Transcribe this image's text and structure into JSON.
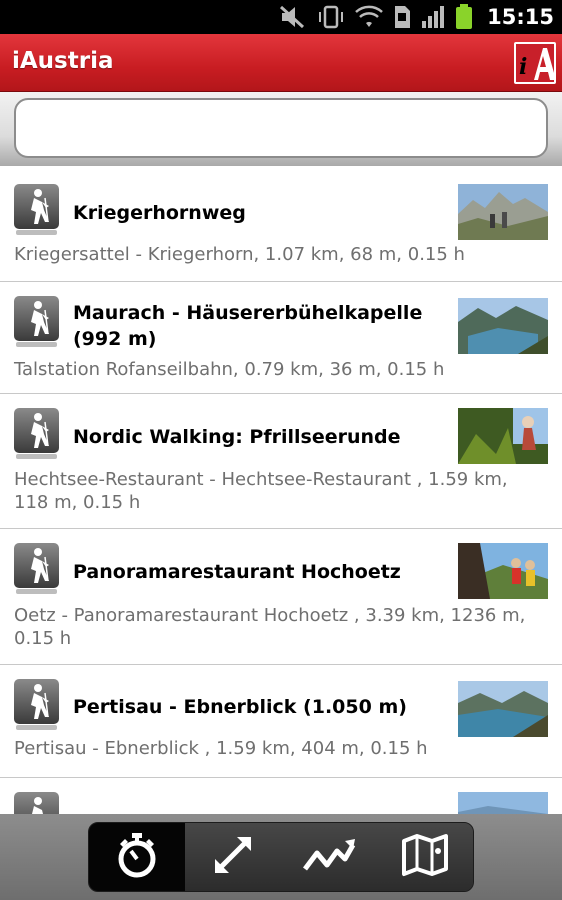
{
  "status_bar": {
    "time": "15:15",
    "icons": [
      "mute-icon",
      "vibrate-icon",
      "wifi-icon",
      "sd-card-icon",
      "signal-icon",
      "battery-icon"
    ]
  },
  "app": {
    "title": "iAustria",
    "logo": "iA",
    "accent_color": "#c8202a"
  },
  "search": {
    "value": "",
    "placeholder": ""
  },
  "routes": [
    {
      "title": "Kriegerhornweg",
      "subtitle": "Kriegersattel - Kriegerhorn, 1.07 km, 68 m, 0.15 h",
      "icon": "hiking-icon"
    },
    {
      "title": "Maurach - Häusererbühelkapelle (992 m)",
      "subtitle": "Talstation Rofanseilbahn, 0.79 km, 36 m, 0.15 h",
      "icon": "hiking-icon"
    },
    {
      "title": "Nordic Walking: Pfrillseerunde",
      "subtitle": "Hechtsee-Restaurant  - Hechtsee-Restaurant , 1.59 km, 118 m, 0.15 h",
      "icon": "hiking-icon"
    },
    {
      "title": "Panoramarestaurant Hochoetz",
      "subtitle": "Oetz - Panoramarestaurant Hochoetz , 3.39 km, 1236 m, 0.15 h",
      "icon": "hiking-icon"
    },
    {
      "title": "Pertisau - Ebnerblick (1.050 m)",
      "subtitle": "Pertisau  - Ebnerblick , 1.59 km, 404 m, 0.15 h",
      "icon": "hiking-icon"
    },
    {
      "title": "",
      "subtitle": "",
      "icon": "hiking-icon"
    }
  ],
  "tabs": [
    {
      "icon": "stopwatch-icon",
      "active": true
    },
    {
      "icon": "distance-arrow-icon",
      "active": false
    },
    {
      "icon": "elevation-chart-icon",
      "active": false
    },
    {
      "icon": "map-icon",
      "active": false
    }
  ]
}
